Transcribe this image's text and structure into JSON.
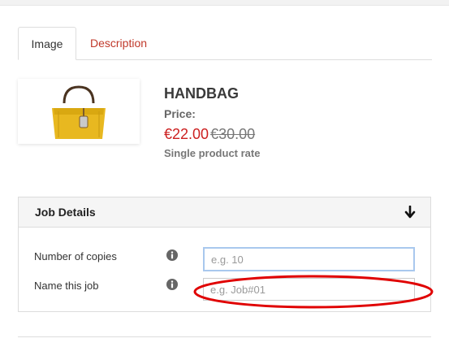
{
  "tabs": [
    {
      "label": "Image",
      "active": true
    },
    {
      "label": "Description",
      "active": false
    }
  ],
  "product": {
    "title": "HANDBAG",
    "price_label": "Price:",
    "price_new": "€22.00",
    "price_old": "€30.00",
    "rate_note": "Single product rate",
    "image_icon": "handbag-image"
  },
  "job_details": {
    "title": "Job Details",
    "toggle_icon": "arrow-down-icon",
    "fields": [
      {
        "label": "Number of copies",
        "placeholder": "e.g. 10",
        "value": ""
      },
      {
        "label": "Name this job",
        "placeholder": "e.g. Job#01",
        "value": ""
      }
    ]
  },
  "colors": {
    "accent_red": "#cc1f1f",
    "tab_link": "#c0392b",
    "annotation": "#e00000",
    "bag_yellow": "#e8b820"
  }
}
